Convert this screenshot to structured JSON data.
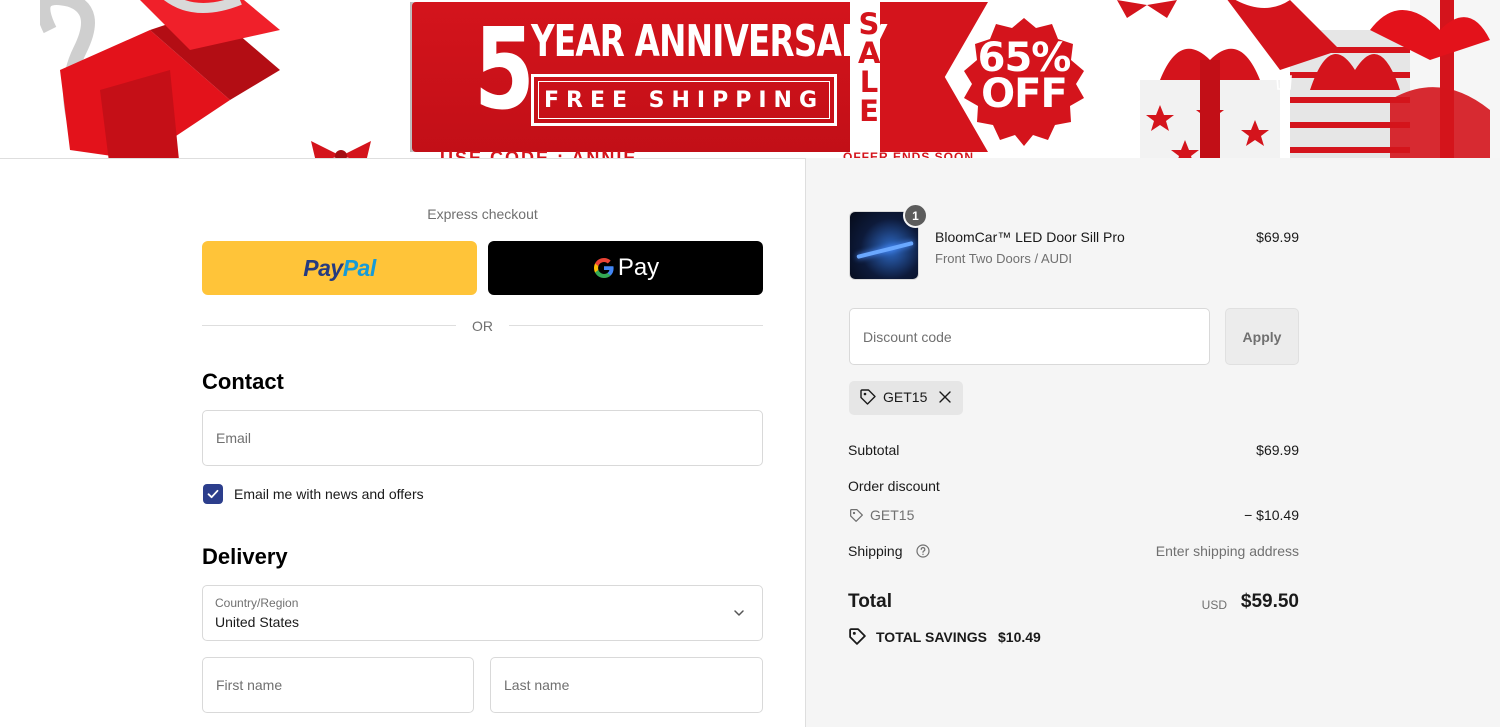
{
  "banner": {
    "number": "5",
    "headline": "YEAR ANNIVERSARY",
    "subline": "FREE SHIPPING",
    "sale_letters": [
      "S",
      "A",
      "L",
      "E"
    ],
    "badge_line1": "65%",
    "badge_line2": "OFF",
    "code_text": "USE CODE : ANNIE",
    "offer_text": "OFFER ENDS SOON",
    "accent_color": "#d4141c"
  },
  "express": {
    "label": "Express checkout",
    "paypal_pay": "Pay",
    "paypal_pal": "Pal",
    "gpay_label": "Pay",
    "or_label": "OR"
  },
  "contact": {
    "heading": "Contact",
    "email_placeholder": "Email",
    "newsletter_label": "Email me with news and offers",
    "newsletter_checked": true
  },
  "delivery": {
    "heading": "Delivery",
    "country_label": "Country/Region",
    "country_value": "United States",
    "first_name_placeholder": "First name",
    "last_name_placeholder": "Last name"
  },
  "summary": {
    "item": {
      "quantity": "1",
      "name": "BloomCar™ LED Door Sill Pro",
      "variant": "Front Two Doors / AUDI",
      "price": "$69.99"
    },
    "discount_placeholder": "Discount code",
    "apply_label": "Apply",
    "applied_code": "GET15",
    "subtotal_label": "Subtotal",
    "subtotal_value": "$69.99",
    "order_discount_label": "Order discount",
    "order_discount_code": "GET15",
    "order_discount_value": "− $10.49",
    "shipping_label": "Shipping",
    "shipping_value": "Enter shipping address",
    "total_label": "Total",
    "total_currency": "USD",
    "total_value": "$59.50",
    "savings_label": "TOTAL SAVINGS",
    "savings_value": "$10.49"
  }
}
